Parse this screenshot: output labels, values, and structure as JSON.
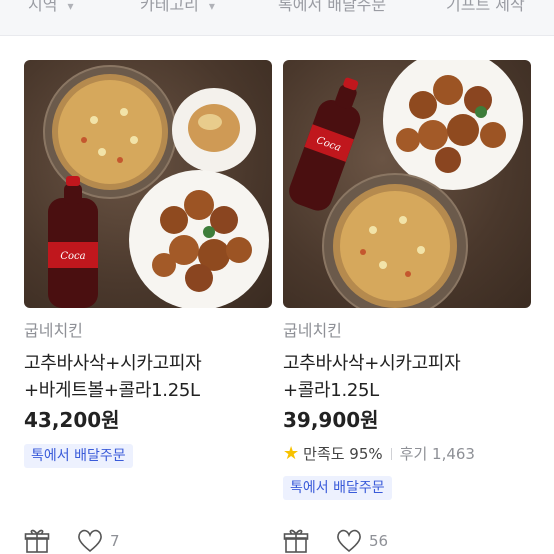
{
  "filter_bar": {
    "items": [
      {
        "label": "지역"
      },
      {
        "label": "카테고리"
      },
      {
        "label": "톡에서 배달주문"
      },
      {
        "label": "기프트 제작"
      }
    ]
  },
  "products": [
    {
      "brand": "굽네치킨",
      "title": "고추바사삭+시카고피자+바게트볼+콜라1.25L",
      "price": "43,200원",
      "tag": "톡에서 배달주문",
      "like_count": "7",
      "image_alt": "chicken-pizza-bread-cola-set"
    },
    {
      "brand": "굽네치킨",
      "title": "고추바사삭+시카고피자+콜라1.25L",
      "price": "39,900원",
      "rating_label": "만족도 95%",
      "reviews_label": "후기 1,463",
      "tag": "톡에서 배달주문",
      "like_count": "56",
      "image_alt": "chicken-pizza-cola-set"
    }
  ],
  "colors": {
    "tag_text": "#3a5bd9",
    "tag_bg": "#edf1fe",
    "star": "#f7c200"
  },
  "icons": [
    "chevron-down-icon",
    "gift-icon",
    "heart-icon",
    "star-icon"
  ]
}
